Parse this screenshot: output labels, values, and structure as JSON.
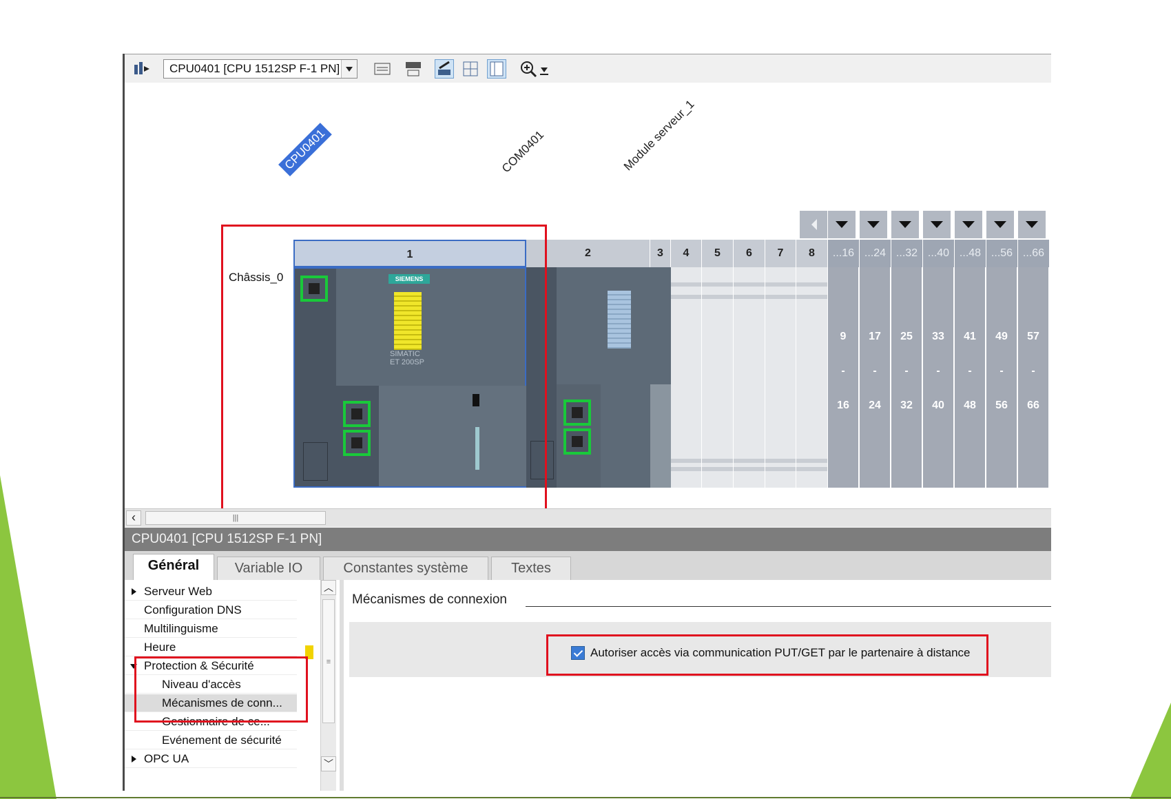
{
  "toolbar": {
    "device_selector_value": "CPU0401 [CPU 1512SP F-1 PN]",
    "icons": [
      "network-view-icon",
      "show-module-labels-icon",
      "rename-icon",
      "edit-icon",
      "grid-icon",
      "table-view-icon",
      "zoom-icon",
      "download-icon"
    ]
  },
  "rack": {
    "chassis_label": "Châssis_0",
    "device_labels": [
      "CPU0401",
      "COM0401",
      "Module serveur_1"
    ],
    "slot_headers": [
      "1",
      "2",
      "3",
      "4",
      "5",
      "6",
      "7",
      "8"
    ],
    "group_headers": [
      "...16",
      "...24",
      "...32",
      "...40",
      "...48",
      "...56",
      "...66"
    ],
    "group_ranges": [
      {
        "start": "9",
        "sep": "-",
        "end": "16"
      },
      {
        "start": "17",
        "sep": "-",
        "end": "24"
      },
      {
        "start": "25",
        "sep": "-",
        "end": "32"
      },
      {
        "start": "33",
        "sep": "-",
        "end": "40"
      },
      {
        "start": "41",
        "sep": "-",
        "end": "48"
      },
      {
        "start": "49",
        "sep": "-",
        "end": "56"
      },
      {
        "start": "57",
        "sep": "-",
        "end": "66"
      }
    ],
    "module_texts": {
      "brand": "SIEMENS",
      "product": "SIMATIC ET 200SP"
    }
  },
  "properties": {
    "title": "CPU0401 [CPU 1512SP F-1 PN]",
    "tabs": [
      "Général",
      "Variable IO",
      "Constantes système",
      "Textes"
    ],
    "active_tab": "Général",
    "tree": [
      {
        "label": "Serveur Web",
        "expander": "collapsed",
        "indent": 0
      },
      {
        "label": "Configuration DNS",
        "expander": "none",
        "indent": 0
      },
      {
        "label": "Multilinguisme",
        "expander": "none",
        "indent": 0
      },
      {
        "label": "Heure",
        "expander": "none",
        "indent": 0
      },
      {
        "label": "Protection & Sécurité",
        "expander": "expanded",
        "indent": 0
      },
      {
        "label": "Niveau d'accès",
        "expander": "none",
        "indent": 1
      },
      {
        "label": "Mécanismes de conn...",
        "expander": "none",
        "indent": 1
      },
      {
        "label": "Gestionnaire de ce...",
        "expander": "none",
        "indent": 1
      },
      {
        "label": "Evénement de sécurité",
        "expander": "none",
        "indent": 1
      },
      {
        "label": "OPC UA",
        "expander": "collapsed",
        "indent": 0
      }
    ],
    "selected_tree_item": "Mécanismes de conn...",
    "section_title": "Mécanismes de connexion",
    "checkbox_label": "Autoriser accès via communication PUT/GET par le partenaire à distance",
    "checkbox_checked": true
  },
  "colors": {
    "highlight_red": "#e0101e",
    "port_green": "#19c93a",
    "selection_blue": "#3a6fd8",
    "slide_green": "#8cc63f"
  }
}
